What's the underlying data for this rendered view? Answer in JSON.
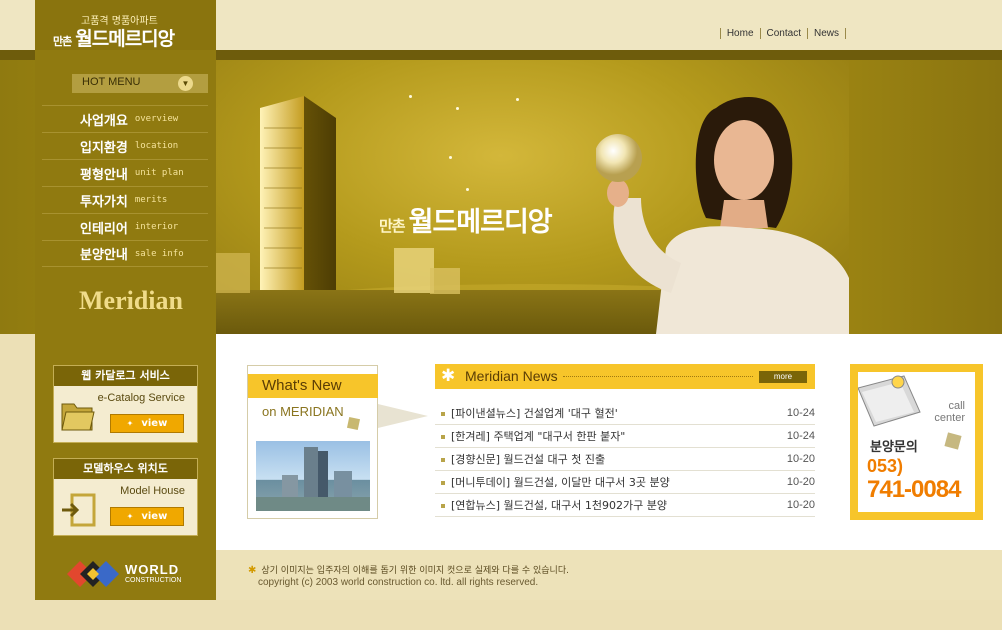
{
  "brand": {
    "subtitle": "고품격 명품아파트",
    "prefix": "만촌",
    "name": "월드메르디앙",
    "logo_text": "Meridian",
    "company_word": "WORLD",
    "company_sub": "CONSTRUCTION"
  },
  "top_nav": [
    {
      "label": "Home"
    },
    {
      "label": "Contact"
    },
    {
      "label": "News"
    }
  ],
  "hot_menu": {
    "label": "HOT MENU",
    "items": [
      {
        "ko": "사업개요",
        "en": "overview"
      },
      {
        "ko": "입지환경",
        "en": "location"
      },
      {
        "ko": "평형안내",
        "en": "unit plan"
      },
      {
        "ko": "투자가치",
        "en": "merits"
      },
      {
        "ko": "인테리어",
        "en": "interior"
      },
      {
        "ko": "분양안내",
        "en": "sale info"
      }
    ]
  },
  "hero": {
    "prefix": "만촌",
    "title": "월드메르디앙"
  },
  "side_boxes": [
    {
      "title": "웹 카달로그 서비스",
      "sub": "e-Catalog Service",
      "button": "view"
    },
    {
      "title": "모델하우스 위치도",
      "sub": "Model House",
      "button": "view"
    }
  ],
  "whats_new": {
    "title": "What's New",
    "sub": "on MERIDIAN"
  },
  "news": {
    "title": "Meridian News",
    "more": "more",
    "items": [
      {
        "title": "[파이낸셜뉴스] 건설업계 '대구 혈전'",
        "date": "10-24"
      },
      {
        "title": "[한겨레] 주택업계 \"대구서 한판 붙자\"",
        "date": "10-24"
      },
      {
        "title": "[경향신문] 월드건설 대구 첫 진출",
        "date": "10-20"
      },
      {
        "title": "[머니투데이] 월드건설, 이달만 대구서 3곳 분양",
        "date": "10-20"
      },
      {
        "title": "[연합뉴스] 월드건설, 대구서 1천902가구 분양",
        "date": "10-20"
      }
    ]
  },
  "call": {
    "label_line1": "call",
    "label_line2": "center",
    "title": "분양문의",
    "area": "053)",
    "number": "741-0084"
  },
  "footer": {
    "note": "상기 이미지는 입주자의 이해를 돕기 위한 이미지 컷으로 실제와 다를 수 있습니다.",
    "copyright": "copyright (c) 2003 world construction co. ltd. all rights reserved."
  },
  "colors": {
    "accent_yellow": "#f7c52a",
    "olive": "#907a10",
    "phone_orange": "#f07d00"
  }
}
